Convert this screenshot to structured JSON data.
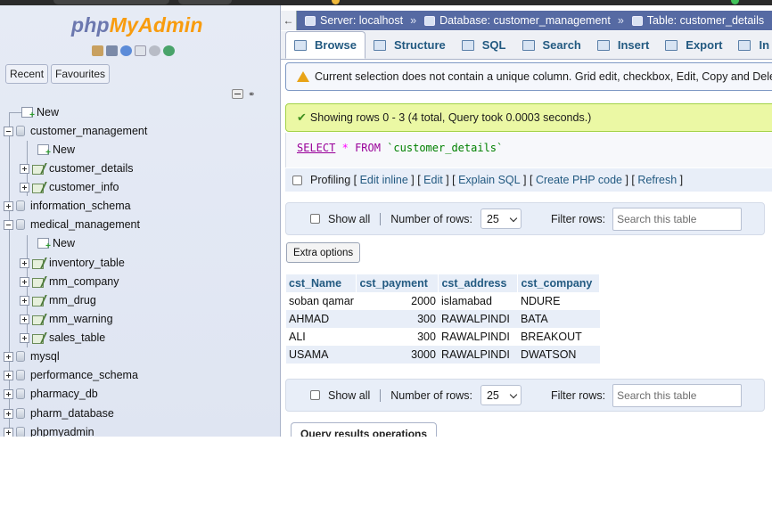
{
  "sidebar": {
    "logo_php": "php",
    "logo_myadmin": "MyAdmin",
    "recent_label": "Recent",
    "favourites_label": "Favourites",
    "tree": [
      {
        "label": "New",
        "type": "new",
        "level": 0
      },
      {
        "label": "customer_management",
        "type": "db",
        "level": 0,
        "expanded": true
      },
      {
        "label": "New",
        "type": "new",
        "level": 1
      },
      {
        "label": "customer_details",
        "type": "table",
        "level": 1,
        "selected": true
      },
      {
        "label": "customer_info",
        "type": "table",
        "level": 1
      },
      {
        "label": "information_schema",
        "type": "db",
        "level": 0
      },
      {
        "label": "medical_management",
        "type": "db",
        "level": 0,
        "expanded": true
      },
      {
        "label": "New",
        "type": "new",
        "level": 1
      },
      {
        "label": "inventory_table",
        "type": "table",
        "level": 1
      },
      {
        "label": "mm_company",
        "type": "table",
        "level": 1
      },
      {
        "label": "mm_drug",
        "type": "table",
        "level": 1
      },
      {
        "label": "mm_warning",
        "type": "table",
        "level": 1
      },
      {
        "label": "sales_table",
        "type": "table",
        "level": 1
      },
      {
        "label": "mysql",
        "type": "db",
        "level": 0
      },
      {
        "label": "performance_schema",
        "type": "db",
        "level": 0
      },
      {
        "label": "pharmacy_db",
        "type": "db",
        "level": 0
      },
      {
        "label": "pharm_database",
        "type": "db",
        "level": 0
      },
      {
        "label": "phpmyadmin",
        "type": "db",
        "level": 0
      }
    ]
  },
  "breadcrumb": {
    "back": "←",
    "server": "Server: localhost",
    "database": "Database: customer_management",
    "table": "Table: customer_details"
  },
  "tabs": [
    {
      "label": "Browse",
      "active": true
    },
    {
      "label": "Structure"
    },
    {
      "label": "SQL"
    },
    {
      "label": "Search"
    },
    {
      "label": "Insert"
    },
    {
      "label": "Export"
    },
    {
      "label": "In"
    }
  ],
  "warning_text": "Current selection does not contain a unique column. Grid edit, checkbox, Edit, Copy and Delete",
  "success_text": "Showing rows 0 - 3 (4 total, Query took 0.0003 seconds.)",
  "query": {
    "select": "SELECT",
    "star": "*",
    "from": "FROM",
    "table": "`customer_details`"
  },
  "profiling": {
    "label": "Profiling",
    "links": [
      "Edit inline",
      "Edit",
      "Explain SQL",
      "Create PHP code",
      "Refresh"
    ]
  },
  "nav": {
    "show_all": "Show all",
    "rows_label": "Number of rows:",
    "rows_value": "25",
    "filter_label": "Filter rows:",
    "search_placeholder": "Search this table"
  },
  "extra_options": "Extra options",
  "results": {
    "columns": [
      "cst_Name",
      "cst_payment",
      "cst_address",
      "cst_company"
    ],
    "rows": [
      [
        "soban qamar",
        "2000",
        "islamabad",
        "NDURE"
      ],
      [
        "AHMAD",
        "300",
        "RAWALPINDI",
        "BATA"
      ],
      [
        "ALI",
        "300",
        "RAWALPINDI",
        "BREAKOUT"
      ],
      [
        "USAMA",
        "3000",
        "RAWALPINDI",
        "DWATSON"
      ]
    ]
  },
  "query_results_operations": "Query results operations",
  "colors": {
    "accent": "#235a81",
    "breadcrumb_bg": "#566aa3",
    "logo_php": "#6c78af",
    "logo_myadmin": "#f89c0e",
    "success_bg": "#ebf8a4"
  }
}
